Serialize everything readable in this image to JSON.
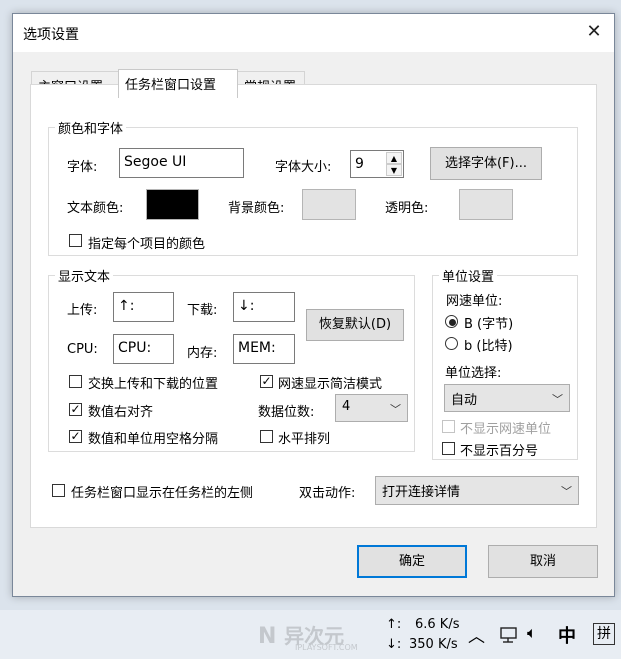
{
  "dialog": {
    "title": "选项设置",
    "tabs": [
      "主窗口设置",
      "任务栏窗口设置",
      "常规设置"
    ],
    "color_font": {
      "legend": "颜色和字体",
      "font_label": "字体:",
      "font_value": "Segoe UI",
      "size_label": "字体大小:",
      "size_value": "9",
      "select_font_button": "选择字体(F)...",
      "text_color_label": "文本颜色:",
      "text_color": "#000000",
      "bg_color_label": "背景颜色:",
      "bg_color": "#e3e3e3",
      "transparent_label": "透明色:",
      "transparent_color": "#e3e3e3",
      "per_item_color": "指定每个项目的颜色"
    },
    "display_text": {
      "legend": "显示文本",
      "upload_label": "上传:",
      "upload_value": "↑:",
      "download_label": "下载:",
      "download_value": "↓:",
      "restore_button": "恢复默认(D)",
      "cpu_label": "CPU:",
      "cpu_value": "CPU:",
      "mem_label": "内存:",
      "mem_value": "MEM:",
      "swap_position": "交换上传和下载的位置",
      "concise_mode": "网速显示简洁模式",
      "right_align": "数值右对齐",
      "digits_label": "数据位数:",
      "digits_value": "4",
      "space_separate": "数值和单位用空格分隔",
      "horizontal": "水平排列"
    },
    "unit": {
      "legend": "单位设置",
      "speed_unit_label": "网速单位:",
      "byte_option": "B (字节)",
      "bit_option": "b (比特)",
      "unit_select_label": "单位选择:",
      "unit_select_value": "自动",
      "hide_speed_unit": "不显示网速单位",
      "hide_percent": "不显示百分号"
    },
    "taskbar_left": "任务栏窗口显示在任务栏的左侧",
    "double_click_label": "双击动作:",
    "double_click_value": "打开连接详情",
    "ok_button": "确定",
    "cancel_button": "取消"
  },
  "taskbar": {
    "watermark": "异次元",
    "watermark_sub": "IPLAYSOFT.COM",
    "up_arrow": "↑:",
    "up_speed": "6.6 K/s",
    "down_arrow": "↓:",
    "down_speed": "350 K/s",
    "ime_label": "中",
    "ime_mode": "拼"
  }
}
